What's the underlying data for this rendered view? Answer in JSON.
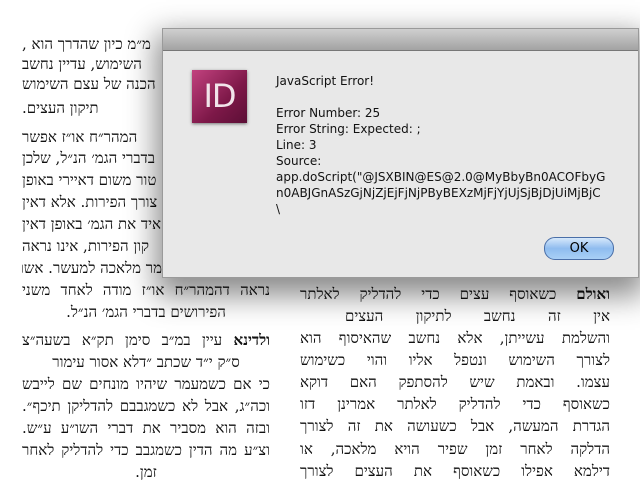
{
  "document": {
    "left_column": [
      "מ״מ כיון שהדרך הוא ,",
      "השימוש, עדיין נחשב",
      "הכנה של עצם השימוש",
      "תיקון העצים.",
      "המהר״ח או״ז אפשר",
      "בדברי הגמ׳ הנ״ל, שלכן",
      "טור משום דאיירי באופן",
      "צורך הפירות. אלא דאין",
      "איד את הגמ׳ באופן דאין",
      "קון הפירות, אינו נראה",
      "מר מלאכה למעשר. אשר",
      "נראה דהמהר״ח או״ז מודה לאחד משני",
      "הפירושים בדברי הגמ׳ הנ״ל.",
      "ולדינא",
      "עיין במ״ב סימן תק״א בשעה״צ",
      "ס״ק י״ד שכתב ״דלא אסור עימור",
      "כי אם כשמעמר שיהיו מונחים שם לייבש",
      "וכה״ג, אבל לא כשמגבבם להדליקן תיכף״.",
      "ובזה הוא מסביר את דברי השו״ע ע״ש.",
      "וצ״ע מה הדין כשמגבב כדי להדליק לאחר",
      "זמן."
    ],
    "right_column": [
      "ואולם",
      "כשאוסף עצים כדי להדליק לאלתר",
      "אין זה נחשב לתיקון העצים",
      "והשלמת עשייתן, אלא נחשב שהאיסוף הוא",
      "לצורך השימוש ונטפל אליו והוי כשימוש",
      "עצמו. ובאמת שיש להסתפק האם דוקא",
      "כשאוסף כדי להדליק לאלתר אמרינן דזו",
      "הגדרת המעשה, אבל כשעושה את זה לצורך",
      "הדלקה לאחר זמן שפיר הויא מלאכה, או",
      "דילמא אפילו כשאוסף את העצים לצורך"
    ]
  },
  "dialog": {
    "icon": "indesign-app-icon",
    "icon_label": "ID",
    "title": "JavaScript Error!",
    "error_number": "Error Number: 25",
    "error_string": "Error String: Expected: ;",
    "line": "Line: 3",
    "source_label": "Source:",
    "source_lines": [
      "app.doScript(\"@JSXBIN@ES@2.0@MyBbyBn0ACOFbyG",
      "n0ABJGnASzGjNjZjEjFjNjPByBEXzMjFjYjUjSjBjDjUiMjBjC",
      "\\"
    ],
    "ok_label": "OK",
    "accent": "#8fbcef"
  }
}
